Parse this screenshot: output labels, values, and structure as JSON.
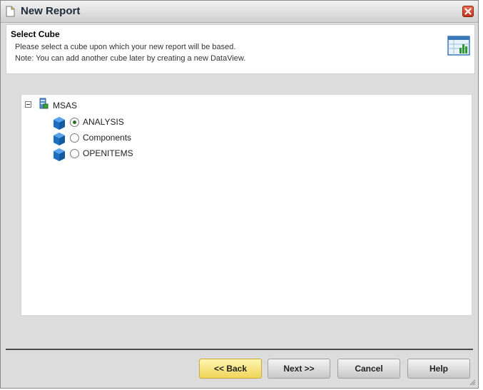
{
  "window": {
    "title": "New Report",
    "accent": "#1e2b3c"
  },
  "header": {
    "title": "Select Cube",
    "line1": "Please select a cube upon which your new report will be based.",
    "line2": "Note: You can add another cube later by creating a new DataView."
  },
  "tree": {
    "root_label": "MSAS",
    "expanded": true,
    "items": [
      {
        "label": "ANALYSIS",
        "selected": true
      },
      {
        "label": "Components",
        "selected": false
      },
      {
        "label": "OPENITEMS",
        "selected": false
      }
    ]
  },
  "buttons": {
    "back": "<< Back",
    "next": "Next >>",
    "cancel": "Cancel",
    "help": "Help"
  },
  "icons": {
    "title": "document-icon",
    "close": "close-icon",
    "header": "report-chart-icon",
    "server": "server-icon",
    "cube": "cube-icon"
  }
}
